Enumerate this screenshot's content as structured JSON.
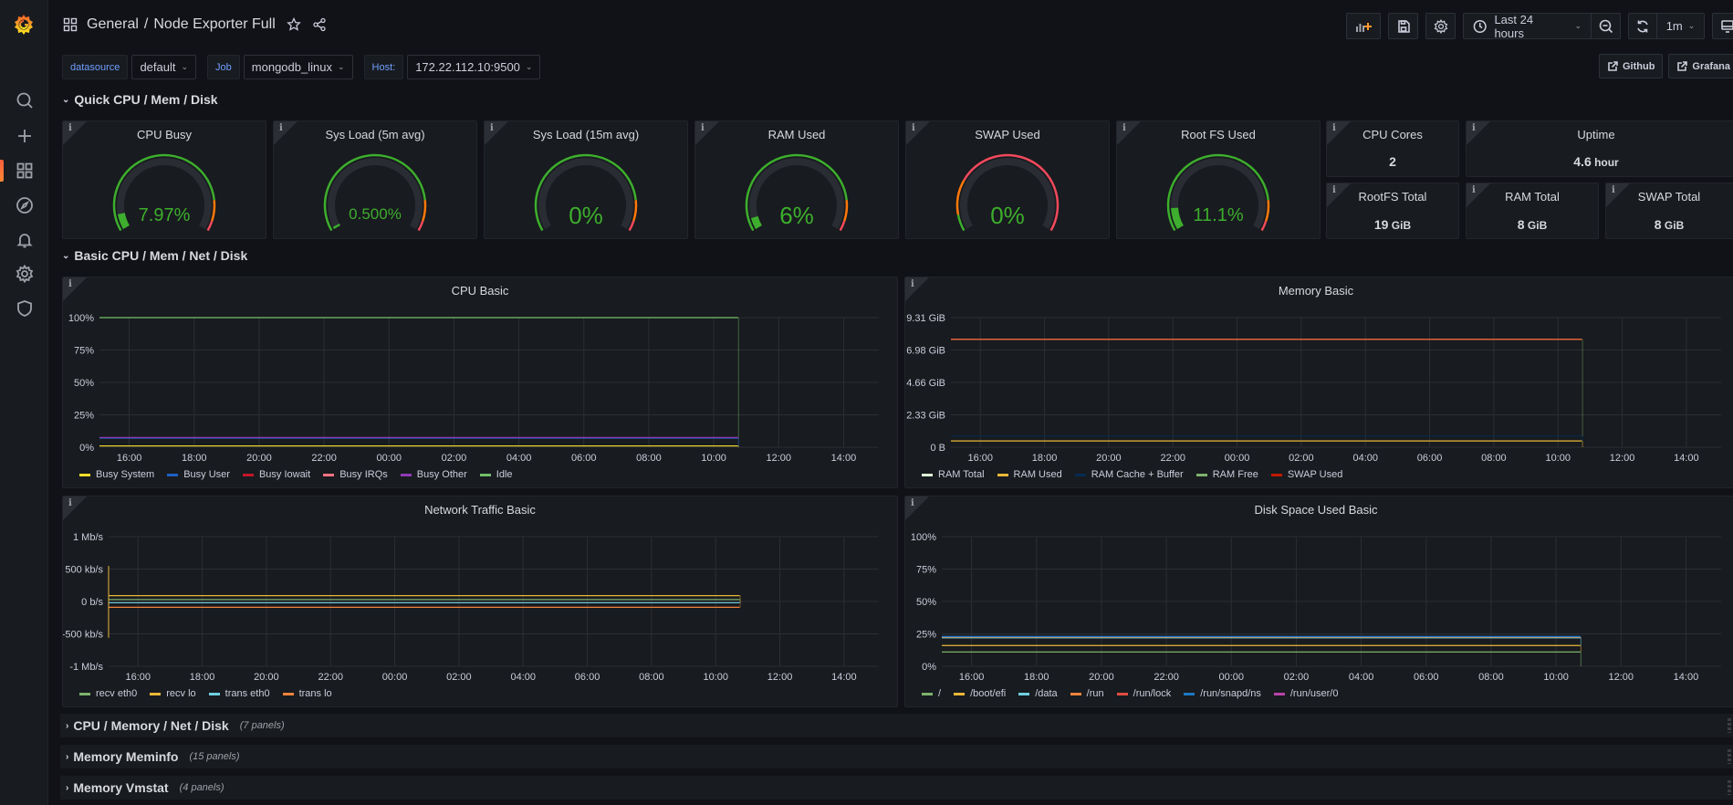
{
  "header": {
    "breadcrumb_folder": "General",
    "breadcrumb_sep": "/",
    "dashboard_title": "Node Exporter Full",
    "time_range": "Last 24 hours",
    "refresh_interval": "1m"
  },
  "sidebar": {
    "items": [
      {
        "name": "search",
        "icon": "search-icon"
      },
      {
        "name": "create",
        "icon": "plus-icon"
      },
      {
        "name": "dashboards",
        "icon": "dashboards-icon",
        "active": true
      },
      {
        "name": "explore",
        "icon": "compass-icon"
      },
      {
        "name": "alerting",
        "icon": "bell-icon"
      },
      {
        "name": "configuration",
        "icon": "gear-icon"
      },
      {
        "name": "server-admin",
        "icon": "shield-icon"
      }
    ]
  },
  "variables": [
    {
      "label": "datasource",
      "value": "default"
    },
    {
      "label": "Job",
      "value": "mongodb_linux"
    },
    {
      "label": "Host:",
      "value": "172.22.112.10:9500"
    }
  ],
  "links": [
    {
      "label": "Github"
    },
    {
      "label": "Grafana"
    }
  ],
  "rows": {
    "quick": "Quick CPU / Mem / Disk",
    "basic": "Basic CPU / Mem / Net / Disk",
    "collapsed": [
      {
        "title": "CPU / Memory / Net / Disk",
        "count": "(7 panels)"
      },
      {
        "title": "Memory Meminfo",
        "count": "(15 panels)"
      },
      {
        "title": "Memory Vmstat",
        "count": "(4 panels)"
      }
    ]
  },
  "gauges": [
    {
      "title": "CPU Busy",
      "value": "7.97%",
      "fraction": 0.0797,
      "scheme": "gyr"
    },
    {
      "title": "Sys Load (5m avg)",
      "value": "0.500%",
      "fraction": 0.005,
      "scheme": "gyr"
    },
    {
      "title": "Sys Load (15m avg)",
      "value": "0%",
      "fraction": 0,
      "scheme": "gyr"
    },
    {
      "title": "RAM Used",
      "value": "6%",
      "fraction": 0.06,
      "scheme": "gyr"
    },
    {
      "title": "SWAP Used",
      "value": "0%",
      "fraction": 0,
      "scheme": "swap"
    },
    {
      "title": "Root FS Used",
      "value": "11.1%",
      "fraction": 0.111,
      "scheme": "gyr"
    }
  ],
  "stats": [
    {
      "title": "CPU Cores",
      "value": "2",
      "unit": ""
    },
    {
      "title": "Uptime",
      "value": "4.6",
      "unit": " hour"
    },
    {
      "title": "RootFS Total",
      "value": "19",
      "unit": " GiB"
    },
    {
      "title": "RAM Total",
      "value": "8",
      "unit": " GiB"
    },
    {
      "title": "SWAP Total",
      "value": "8",
      "unit": " GiB"
    }
  ],
  "colors": {
    "green": "#37872d",
    "gauge_green": "#3dae2d",
    "orange": "#ff780a",
    "red": "#f2495c"
  },
  "chart_data": [
    {
      "type": "area",
      "title": "CPU Basic",
      "x_ticks": [
        "16:00",
        "18:00",
        "20:00",
        "22:00",
        "00:00",
        "02:00",
        "04:00",
        "06:00",
        "08:00",
        "10:00",
        "12:00",
        "14:00"
      ],
      "y_ticks": [
        "0%",
        "25%",
        "50%",
        "75%",
        "100%"
      ],
      "ylim": [
        0,
        100
      ],
      "data_start": "10:45",
      "data_end": "15:05",
      "series": [
        {
          "name": "Busy System",
          "color": "#fade2a",
          "value": 1
        },
        {
          "name": "Busy User",
          "color": "#1f60c4",
          "value": 6
        },
        {
          "name": "Busy Iowait",
          "color": "#c4162a",
          "value": 0
        },
        {
          "name": "Busy IRQs",
          "color": "#ff7383",
          "value": 0
        },
        {
          "name": "Busy Other",
          "color": "#8f3bb8",
          "value": 0.5
        },
        {
          "name": "Idle",
          "color": "#73bf69",
          "value": 92.5
        }
      ]
    },
    {
      "type": "area",
      "title": "Memory Basic",
      "x_ticks": [
        "16:00",
        "18:00",
        "20:00",
        "22:00",
        "00:00",
        "02:00",
        "04:00",
        "06:00",
        "08:00",
        "10:00",
        "12:00",
        "14:00"
      ],
      "y_ticks": [
        "0 B",
        "2.33 GiB",
        "4.66 GiB",
        "6.98 GiB",
        "9.31 GiB"
      ],
      "ylim": [
        0,
        9.31
      ],
      "data_start": "10:45",
      "data_end": "15:05",
      "series": [
        {
          "name": "RAM Total",
          "color": "#e0f9d7",
          "value": 7.75
        },
        {
          "name": "RAM Used",
          "color": "#eab839",
          "value": 0.45
        },
        {
          "name": "RAM Cache + Buffer",
          "color": "#052b51",
          "value": 0.35
        },
        {
          "name": "RAM Free",
          "color": "#7eb26d",
          "value": 6.95
        },
        {
          "name": "SWAP Used",
          "color": "#bf1b00",
          "value": 0
        }
      ]
    },
    {
      "type": "area",
      "title": "Network Traffic Basic",
      "x_ticks": [
        "16:00",
        "18:00",
        "20:00",
        "22:00",
        "00:00",
        "02:00",
        "04:00",
        "06:00",
        "08:00",
        "10:00",
        "12:00",
        "14:00"
      ],
      "y_ticks": [
        "-1 Mb/s",
        "-500 kb/s",
        "0 b/s",
        "500 kb/s",
        "1 Mb/s"
      ],
      "ylim": [
        -1000,
        1000
      ],
      "data_start": "10:45",
      "data_end": "15:05",
      "series": [
        {
          "name": "recv eth0",
          "color": "#7eb26d",
          "value": 30
        },
        {
          "name": "recv lo",
          "color": "#eab839",
          "value": 90
        },
        {
          "name": "trans eth0",
          "color": "#6ed0e0",
          "value": -20
        },
        {
          "name": "trans lo",
          "color": "#ef843c",
          "value": -90
        }
      ]
    },
    {
      "type": "area",
      "title": "Disk Space Used Basic",
      "x_ticks": [
        "16:00",
        "18:00",
        "20:00",
        "22:00",
        "00:00",
        "02:00",
        "04:00",
        "06:00",
        "08:00",
        "10:00",
        "12:00",
        "14:00"
      ],
      "y_ticks": [
        "0%",
        "25%",
        "50%",
        "75%",
        "100%"
      ],
      "ylim": [
        0,
        100
      ],
      "data_start": "10:45",
      "data_end": "15:05",
      "series": [
        {
          "name": "/",
          "color": "#7eb26d",
          "value": 11
        },
        {
          "name": "/boot/efi",
          "color": "#eab839",
          "value": 5
        },
        {
          "name": "/data",
          "color": "#6ed0e0",
          "value": 6
        },
        {
          "name": "/run",
          "color": "#ef843c",
          "value": 0.5
        },
        {
          "name": "/run/lock",
          "color": "#e24d42",
          "value": 0
        },
        {
          "name": "/run/snapd/ns",
          "color": "#1f78c1",
          "value": 0.5
        },
        {
          "name": "/run/user/0",
          "color": "#ba43a9",
          "value": 0
        }
      ]
    }
  ]
}
